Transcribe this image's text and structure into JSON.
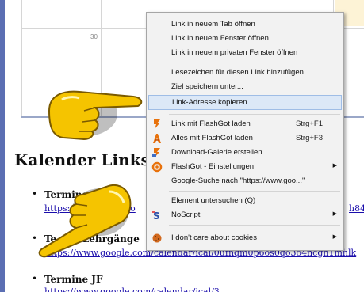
{
  "calendar": {
    "day_label": "30"
  },
  "page": {
    "heading": "Kalender Links zu",
    "items": [
      {
        "title": "Termine",
        "link_left": "https://",
        "link_mid": "co",
        "link_right": "h84"
      },
      {
        "title_left": "Te",
        "title_right": "e Lehrgänge",
        "link": "https://www.google.com/calendar/ical/0ufnqm0p6os0qo3o4ncgn1mhlk"
      },
      {
        "title": "Termine JF"
      }
    ]
  },
  "context_menu": {
    "items": [
      {
        "label": "Link in neuem Tab öffnen",
        "icon": "",
        "shortcut": "",
        "submenu": false
      },
      {
        "label": "Link in neuem Fenster öffnen",
        "icon": "",
        "shortcut": "",
        "submenu": false
      },
      {
        "label": "Link in neuem privaten Fenster öffnen",
        "icon": "",
        "shortcut": "",
        "submenu": false
      },
      {
        "label": "Lesezeichen für diesen Link hinzufügen",
        "icon": "",
        "shortcut": "",
        "submenu": false
      },
      {
        "label": "Ziel speichern unter...",
        "icon": "",
        "shortcut": "",
        "submenu": false
      },
      {
        "label": "Link-Adresse kopieren",
        "icon": "",
        "shortcut": "",
        "submenu": false,
        "highlighted": true
      },
      {
        "label": "Link mit FlashGot laden",
        "icon": "flashgot-icon",
        "shortcut": "Strg+F1",
        "submenu": false
      },
      {
        "label": "Alles mit FlashGot laden",
        "icon": "flashgot-all-icon",
        "shortcut": "Strg+F3",
        "submenu": false
      },
      {
        "label": "Download-Galerie erstellen...",
        "icon": "gallery-icon",
        "shortcut": "",
        "submenu": false
      },
      {
        "label": "FlashGot - Einstellungen",
        "icon": "flashgot-settings-icon",
        "shortcut": "",
        "submenu": true
      },
      {
        "label": "Google-Suche nach \"https://www.goo...\"",
        "icon": "",
        "shortcut": "",
        "submenu": false
      },
      {
        "label": "Element untersuchen (Q)",
        "icon": "",
        "shortcut": "",
        "submenu": false
      },
      {
        "label": "NoScript",
        "icon": "noscript-icon",
        "shortcut": "",
        "submenu": true
      },
      {
        "label": "I don't care about cookies",
        "icon": "cookie-icon",
        "shortcut": "",
        "submenu": true
      }
    ]
  }
}
